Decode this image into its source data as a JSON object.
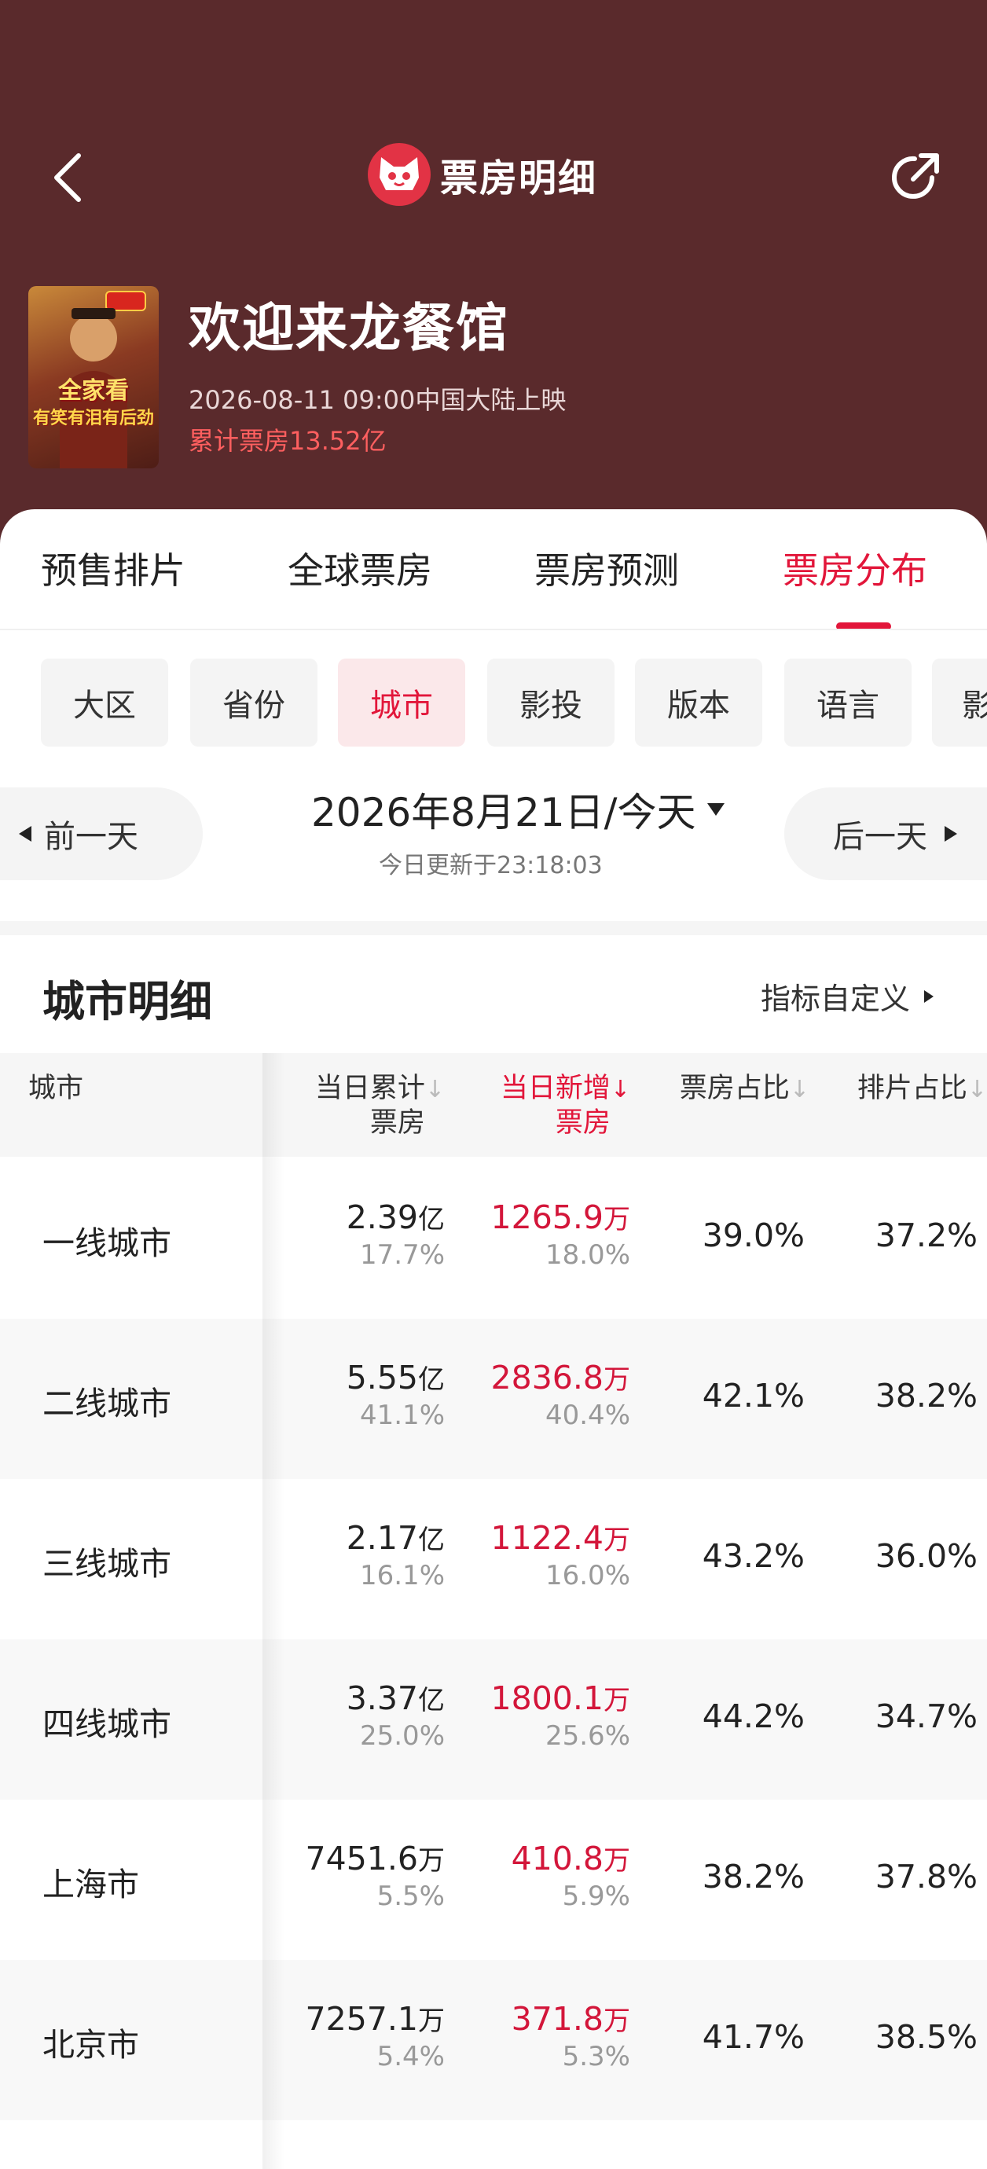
{
  "nav": {
    "title": "票房明细"
  },
  "movie": {
    "title": "欢迎来龙餐馆",
    "release": "2026-08-11 09:00中国大陆上映",
    "total_box_office": "累计票房13.52亿",
    "poster_text_1": "全家看",
    "poster_text_2": "有笑有泪有后劲"
  },
  "tabs": [
    {
      "label": "预售排片",
      "active": false
    },
    {
      "label": "全球票房",
      "active": false
    },
    {
      "label": "票房预测",
      "active": false
    },
    {
      "label": "票房分布",
      "active": true
    }
  ],
  "chips": [
    {
      "label": "大区",
      "active": false
    },
    {
      "label": "省份",
      "active": false
    },
    {
      "label": "城市",
      "active": true
    },
    {
      "label": "影投",
      "active": false
    },
    {
      "label": "版本",
      "active": false
    },
    {
      "label": "语言",
      "active": false
    },
    {
      "label": "影",
      "active": false
    }
  ],
  "date_nav": {
    "prev_label": "前一天",
    "next_label": "后一天",
    "date": "2026年8月21日/今天",
    "updated": "今日更新于23:18:03"
  },
  "section": {
    "title": "城市明细",
    "customize_label": "指标自定义"
  },
  "table": {
    "headers": {
      "city": "城市",
      "cum_line1": "当日累计",
      "cum_line2": "票房",
      "new_line1": "当日新增",
      "new_line2": "票房",
      "share": "票房占比",
      "screen": "排片占比",
      "sort_down": "↓"
    },
    "rows": [
      {
        "city": "一线城市",
        "cum": "2.39",
        "cum_unit": "亿",
        "cum_pct": "17.7%",
        "new": "1265.9",
        "new_unit": "万",
        "new_pct": "18.0%",
        "share": "39.0%",
        "screen": "37.2%"
      },
      {
        "city": "二线城市",
        "cum": "5.55",
        "cum_unit": "亿",
        "cum_pct": "41.1%",
        "new": "2836.8",
        "new_unit": "万",
        "new_pct": "40.4%",
        "share": "42.1%",
        "screen": "38.2%"
      },
      {
        "city": "三线城市",
        "cum": "2.17",
        "cum_unit": "亿",
        "cum_pct": "16.1%",
        "new": "1122.4",
        "new_unit": "万",
        "new_pct": "16.0%",
        "share": "43.2%",
        "screen": "36.0%"
      },
      {
        "city": "四线城市",
        "cum": "3.37",
        "cum_unit": "亿",
        "cum_pct": "25.0%",
        "new": "1800.1",
        "new_unit": "万",
        "new_pct": "25.6%",
        "share": "44.2%",
        "screen": "34.7%"
      },
      {
        "city": "上海市",
        "cum": "7451.6",
        "cum_unit": "万",
        "cum_pct": "5.5%",
        "new": "410.8",
        "new_unit": "万",
        "new_pct": "5.9%",
        "share": "38.2%",
        "screen": "37.8%"
      },
      {
        "city": "北京市",
        "cum": "7257.1",
        "cum_unit": "万",
        "cum_pct": "5.4%",
        "new": "371.8",
        "new_unit": "万",
        "new_pct": "5.3%",
        "share": "41.7%",
        "screen": "38.5%"
      }
    ]
  },
  "colors": {
    "header_bg": "#5a2a2c",
    "accent": "#e2163a",
    "brand_logo": "#e23345"
  }
}
